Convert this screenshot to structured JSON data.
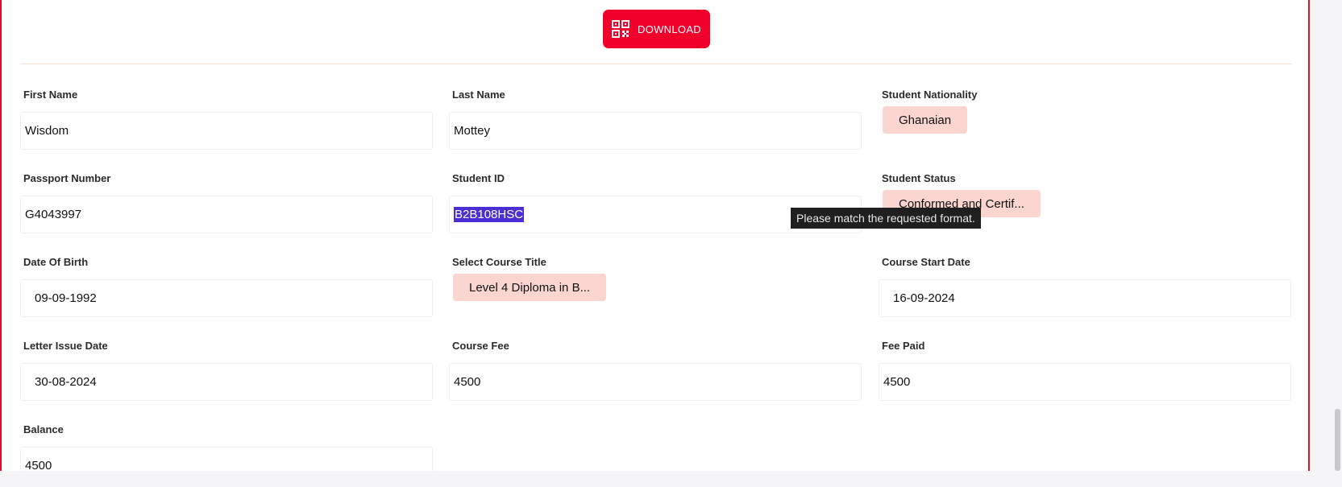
{
  "toolbar": {
    "download_label": "DOWNLOAD"
  },
  "fields": {
    "first_name": {
      "label": "First Name",
      "value": "Wisdom"
    },
    "last_name": {
      "label": "Last Name",
      "value": "Mottey"
    },
    "nationality": {
      "label": "Student Nationality",
      "value": "Ghanaian"
    },
    "passport": {
      "label": "Passport Number",
      "value": "G4043997"
    },
    "student_id": {
      "label": "Student ID",
      "value": "B2B108HSC"
    },
    "status": {
      "label": "Student Status",
      "value": "Conformed and Certif..."
    },
    "dob": {
      "label": "Date Of Birth",
      "value": "09-09-1992"
    },
    "course_title": {
      "label": "Select Course Title",
      "value": "Level 4 Diploma in B..."
    },
    "course_start": {
      "label": "Course Start Date",
      "value": "16-09-2024"
    },
    "letter_issue": {
      "label": "Letter Issue Date",
      "value": "30-08-2024"
    },
    "course_fee": {
      "label": "Course Fee",
      "value": "4500"
    },
    "fee_paid": {
      "label": "Fee Paid",
      "value": "4500"
    },
    "balance": {
      "label": "Balance",
      "value": "4500"
    }
  },
  "tooltip": {
    "text": "Please match the requested format."
  },
  "colors": {
    "accent": "#f0002b",
    "chip_bg": "#fbd6d0",
    "border": "#e0102b"
  }
}
